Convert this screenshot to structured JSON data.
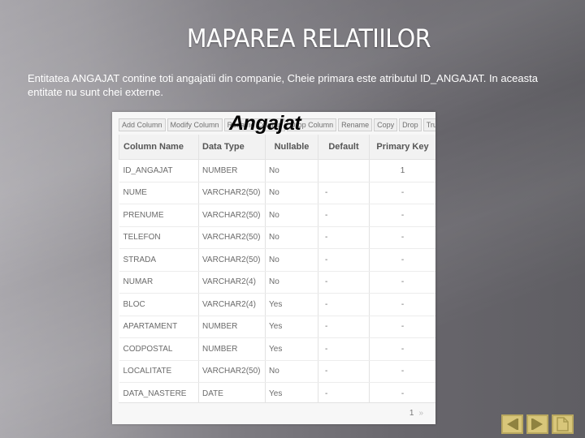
{
  "slide": {
    "title": "MAPAREA RELATIILOR",
    "description": "Entitatea ANGAJAT contine toti angajatii din companie, Cheie primara este atributul ID_ANGAJAT. In aceasta entitate nu sunt chei externe."
  },
  "panel": {
    "entity_label": "Angajat",
    "toolbar": [
      {
        "label": "Add Column"
      },
      {
        "label": "Modify Column"
      },
      {
        "label": "Rename Column"
      },
      {
        "label": "Drop Column"
      },
      {
        "label": "Rename"
      },
      {
        "label": "Copy"
      },
      {
        "label": "Drop"
      },
      {
        "label": "Truncate"
      }
    ],
    "table": {
      "headers": [
        "Column Name",
        "Data Type",
        "Nullable",
        "Default",
        "Primary Key"
      ],
      "rows": [
        [
          "ID_ANGAJAT",
          "NUMBER",
          "No",
          "",
          "1"
        ],
        [
          "NUME",
          "VARCHAR2(50)",
          "No",
          "-",
          "-"
        ],
        [
          "PRENUME",
          "VARCHAR2(50)",
          "No",
          "-",
          "-"
        ],
        [
          "TELEFON",
          "VARCHAR2(50)",
          "No",
          "-",
          "-"
        ],
        [
          "STRADA",
          "VARCHAR2(50)",
          "No",
          "-",
          "-"
        ],
        [
          "NUMAR",
          "VARCHAR2(4)",
          "No",
          "-",
          "-"
        ],
        [
          "BLOC",
          "VARCHAR2(4)",
          "Yes",
          "-",
          "-"
        ],
        [
          "APARTAMENT",
          "NUMBER",
          "Yes",
          "-",
          "-"
        ],
        [
          "CODPOSTAL",
          "NUMBER",
          "Yes",
          "-",
          "-"
        ],
        [
          "LOCALITATE",
          "VARCHAR2(50)",
          "No",
          "-",
          "-"
        ],
        [
          "DATA_NASTERE",
          "DATE",
          "Yes",
          "-",
          "-"
        ]
      ]
    },
    "pager": {
      "current": "1",
      "next": "»"
    }
  },
  "slide_nav": [
    {
      "icon": "previous-slide-icon"
    },
    {
      "icon": "next-slide-icon"
    },
    {
      "icon": "document-icon"
    }
  ],
  "colors": {
    "nav_button": "#d8c67a",
    "nav_glyph": "#8f8240"
  }
}
